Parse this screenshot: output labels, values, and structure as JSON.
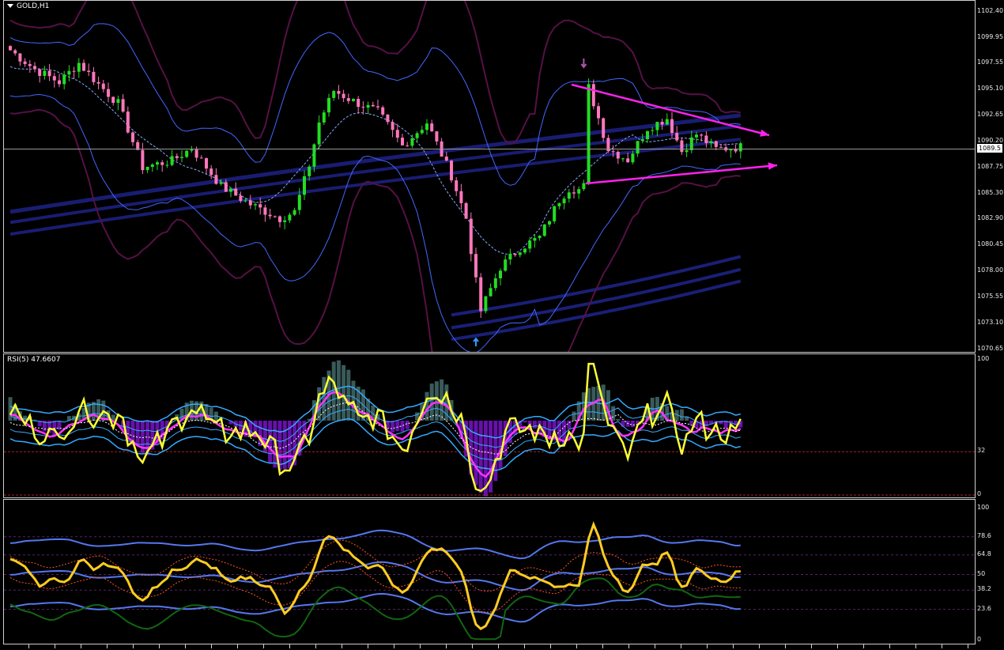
{
  "window": {
    "symbol_title": "GOLD,H1"
  },
  "price_pane": {
    "axis_labels": [
      "1102.40",
      "1099.95",
      "1097.55",
      "1095.10",
      "1092.65",
      "1090.20",
      "1087.75",
      "1085.30",
      "1082.90",
      "1080.45",
      "1078.00",
      "1075.55",
      "1073.10",
      "1070.65"
    ],
    "current_price": "1089.5",
    "colors": {
      "bull": "#22dd22",
      "bear": "#ff77bb",
      "bollinger": "#4466ff",
      "envelope": "#551144",
      "ma_band": "#1a1f77",
      "trendline": "#ff22ee",
      "fast_ma": "#88aaff"
    },
    "markers": {
      "sell_arrow": "arrow-down-icon",
      "buy_arrow": "arrow-up-icon"
    }
  },
  "rsi_pane": {
    "title": "RSI(5) 47.6607",
    "axis_labels": [
      "100",
      "32",
      "0"
    ],
    "colors": {
      "rsi": "#ffff33",
      "bands": "#33aaff",
      "signal": "#ff33ff",
      "hist_pos": "#3a5a5a",
      "hist_neg": "#6611aa"
    }
  },
  "stoch_pane": {
    "axis_labels": [
      "100",
      "78.6",
      "64.8",
      "50",
      "38.2",
      "23.6",
      "0"
    ],
    "colors": {
      "main": "#ffcc22",
      "bands": "#5577ee",
      "green": "#116611",
      "dotted": "#ff5522"
    }
  }
}
